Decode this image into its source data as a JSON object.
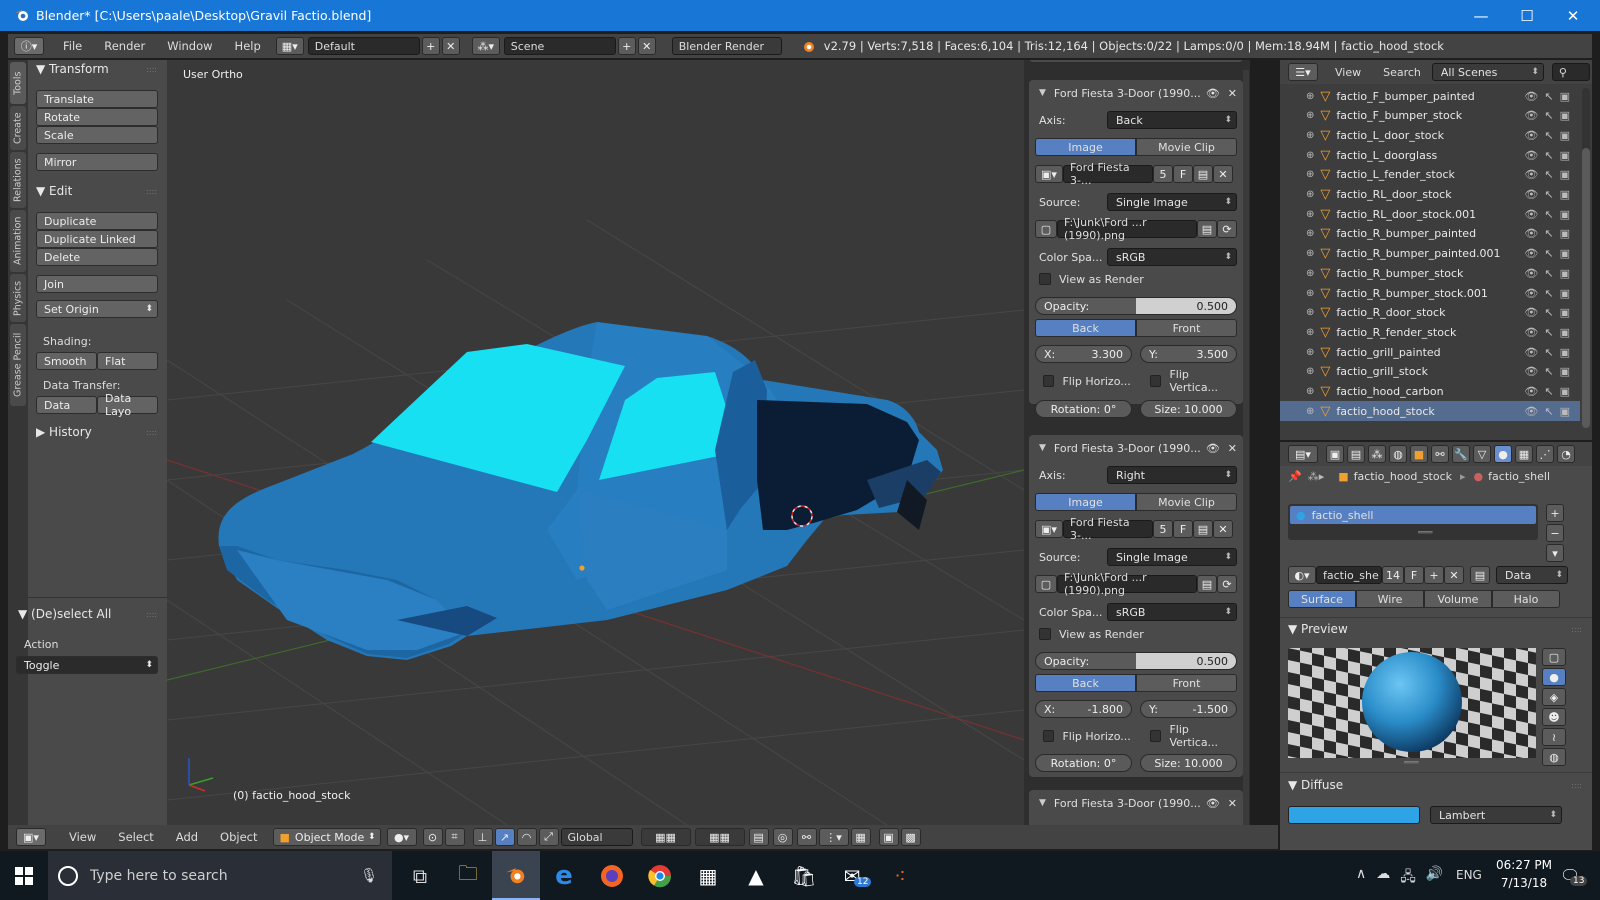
{
  "window": {
    "title": "Blender* [C:\\Users\\paale\\Desktop\\Gravil Factio.blend]",
    "minimize": "—",
    "maximize": "☐",
    "close": "✕"
  },
  "header": {
    "menus": [
      "File",
      "Render",
      "Window",
      "Help"
    ],
    "layout": "Default",
    "scene": "Scene",
    "engine": "Blender Render",
    "stats": "v2.79 | Verts:7,518 | Faces:6,104 | Tris:12,164 | Objects:0/22 | Lamps:0/0 | Mem:18.94M | factio_hood_stock"
  },
  "side_tabs": [
    "Tools",
    "Create",
    "Relations",
    "Animation",
    "Physics",
    "Grease Pencil"
  ],
  "toolshelf": {
    "transform": "Transform",
    "translate": "Translate",
    "rotate": "Rotate",
    "scale": "Scale",
    "mirror": "Mirror",
    "edit": "Edit",
    "duplicate": "Duplicate",
    "duplicate_linked": "Duplicate Linked",
    "delete": "Delete",
    "join": "Join",
    "set_origin": "Set Origin",
    "shading": "Shading:",
    "smooth": "Smooth",
    "flat": "Flat",
    "data_transfer": "Data Transfer:",
    "data": "Data",
    "data_layout": "Data Layo",
    "history": "History",
    "deselect_all": "(De)select All",
    "action": "Action",
    "toggle": "Toggle"
  },
  "viewport": {
    "view_label": "User Ortho",
    "object_label": "(0) factio_hood_stock"
  },
  "bottom_bar": {
    "menus": [
      "View",
      "Select",
      "Add",
      "Object"
    ],
    "mode": "Object Mode",
    "orientation": "Global"
  },
  "bg_images": [
    {
      "title": "Ford Fiesta 3-Door (1990...",
      "axis_label": "Axis:",
      "axis": "Back",
      "tab_image": "Image",
      "tab_clip": "Movie Clip",
      "image_name": "Ford Fiesta 3-...",
      "users": "5",
      "fake": "F",
      "source_label": "Source:",
      "source": "Single Image",
      "filepath": "F:\\Junk\\Ford ...r (1990).png",
      "colorspace_label": "Color Spa...",
      "colorspace": "sRGB",
      "view_as_render": "View as Render",
      "opacity_label": "Opacity:",
      "opacity": "0.500",
      "back": "Back",
      "front": "Front",
      "x_label": "X:",
      "x": "3.300",
      "y_label": "Y:",
      "y": "3.500",
      "flip_h": "Flip Horizo...",
      "flip_v": "Flip Vertica...",
      "rotation": "Rotation: 0°",
      "size": "Size: 10.000"
    },
    {
      "title": "Ford Fiesta 3-Door (1990...",
      "axis_label": "Axis:",
      "axis": "Right",
      "tab_image": "Image",
      "tab_clip": "Movie Clip",
      "image_name": "Ford Fiesta 3-...",
      "users": "5",
      "fake": "F",
      "source_label": "Source:",
      "source": "Single Image",
      "filepath": "F:\\Junk\\Ford ...r (1990).png",
      "colorspace_label": "Color Spa...",
      "colorspace": "sRGB",
      "view_as_render": "View as Render",
      "opacity_label": "Opacity:",
      "opacity": "0.500",
      "back": "Back",
      "front": "Front",
      "x_label": "X:",
      "x": "-1.800",
      "y_label": "Y:",
      "y": "-1.500",
      "flip_h": "Flip Horizo...",
      "flip_v": "Flip Vertica...",
      "rotation": "Rotation: 0°",
      "size": "Size: 10.000"
    },
    {
      "title": "Ford Fiesta 3-Door (1990..."
    }
  ],
  "outliner": {
    "view": "View",
    "search": "Search",
    "scenes": "All Scenes",
    "items": [
      "factio_F_bumper_painted",
      "factio_F_bumper_stock",
      "factio_L_door_stock",
      "factio_L_doorglass",
      "factio_L_fender_stock",
      "factio_RL_door_stock",
      "factio_RL_door_stock.001",
      "factio_R_bumper_painted",
      "factio_R_bumper_painted.001",
      "factio_R_bumper_stock",
      "factio_R_bumper_stock.001",
      "factio_R_door_stock",
      "factio_R_fender_stock",
      "factio_grill_painted",
      "factio_grill_stock",
      "factio_hood_carbon",
      "factio_hood_stock"
    ]
  },
  "material": {
    "object": "factio_hood_stock",
    "material": "factio_shell",
    "slot": "factio_shell",
    "mat_field": "factio_she",
    "users": "14",
    "fake": "F",
    "link": "Data",
    "tabs": [
      "Surface",
      "Wire",
      "Volume",
      "Halo"
    ],
    "preview": "Preview",
    "diffuse": "Diffuse",
    "shader": "Lambert",
    "diffuse_color": "#2ea4e6"
  },
  "taskbar": {
    "search": "Type here to search",
    "lang": "ENG",
    "time": "06:27 PM",
    "date": "7/13/18",
    "notif": "13",
    "mail_badge": "12"
  }
}
